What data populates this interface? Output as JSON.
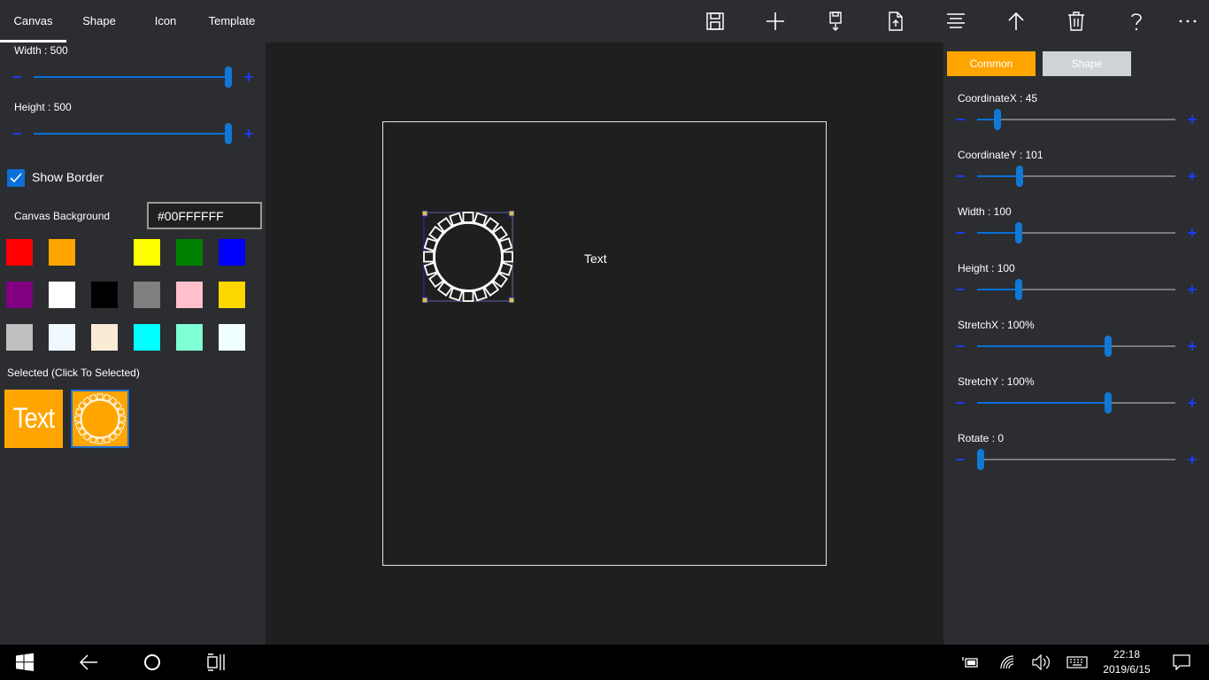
{
  "tabs": [
    {
      "label": "Canvas",
      "active": true
    },
    {
      "label": "Shape",
      "active": false
    },
    {
      "label": "Icon",
      "active": false
    },
    {
      "label": "Template",
      "active": false
    }
  ],
  "toolbar": [
    "save-icon",
    "add-icon",
    "save-as-icon",
    "export-file-icon",
    "align-icon",
    "move-up-icon",
    "delete-icon",
    "help-icon",
    "more-icon"
  ],
  "left": {
    "width_label": "Width : 500",
    "height_label": "Height : 500",
    "show_border_label": "Show Border",
    "show_border_checked": true,
    "canvas_background_label": "Canvas Background",
    "canvas_background_value": "#00FFFFFF",
    "swatches": [
      [
        "#ff0000",
        "#ffa500",
        "",
        "#ffff00",
        "#008000",
        "#0000ff"
      ],
      [
        "#800080",
        "#ffffff",
        "#000000",
        "#808080",
        "#ffc0cb",
        "#ffd700"
      ],
      [
        "#c0c0c0",
        "#f0f8ff",
        "#faebd7",
        "#00ffff",
        "#7fffd4",
        "#f0ffff"
      ]
    ],
    "selected_label": "Selected (Click To Selected)",
    "selected_items": [
      "Text"
    ]
  },
  "canvas": {
    "text": "Text"
  },
  "right": {
    "tab_common": "Common",
    "tab_shape": "Shape",
    "coordx_label": "CoordinateX : 45",
    "coordy_label": "CoordinateY : 101",
    "width_label": "Width : 100",
    "height_label": "Height : 100",
    "stretchx_label": "StretchX : 100%",
    "stretchy_label": "StretchY : 100%",
    "rotate_label": "Rotate : 0",
    "accent": "#ffa500"
  },
  "taskbar": {
    "time": "22:18",
    "date": "2019/6/15"
  }
}
